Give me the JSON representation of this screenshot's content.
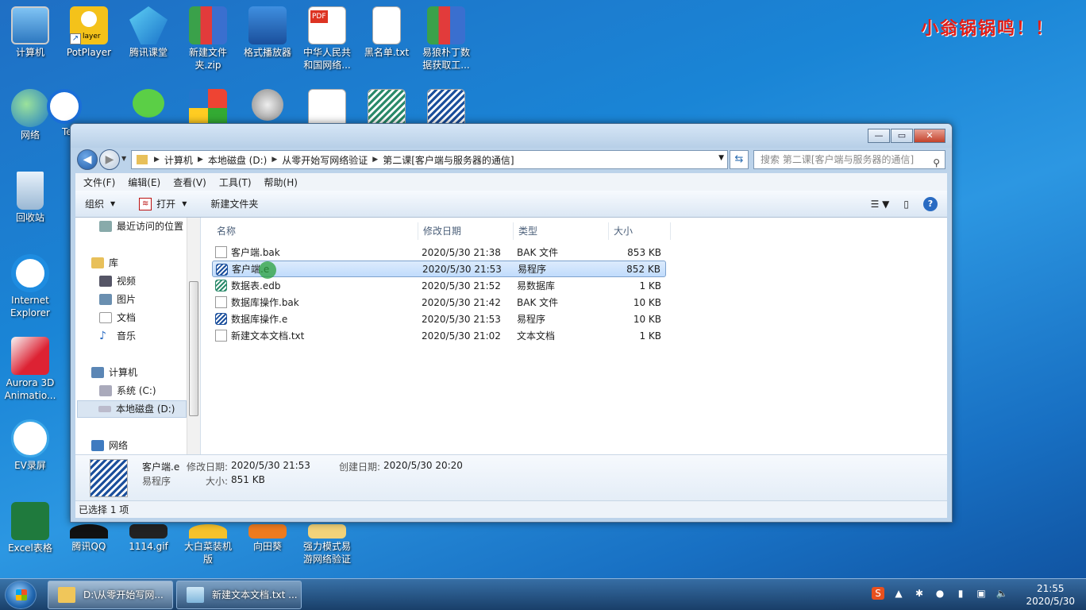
{
  "watermark": "小翁锅锅鸣！！",
  "desktop": {
    "icons": [
      {
        "label": "计算机"
      },
      {
        "label": "PotPlayer"
      },
      {
        "label": "腾讯课堂"
      },
      {
        "label": "新建文件夹.zip"
      },
      {
        "label": "格式播放器"
      },
      {
        "label": "中华人民共和国网络..."
      },
      {
        "label": "黑名单.txt"
      },
      {
        "label": "易狼朴丁数据获取工..."
      },
      {
        "label": "网络"
      },
      {
        "label": "Te"
      },
      {
        "label": "回收站"
      },
      {
        "label": "Internet Explorer"
      },
      {
        "label": "Aurora 3D Animatio..."
      },
      {
        "label": "EV录屏"
      },
      {
        "label": "Excel表格"
      },
      {
        "label": "腾讯QQ"
      },
      {
        "label": "1114.gif"
      },
      {
        "label": "大白菜装机版"
      },
      {
        "label": "向田葵"
      },
      {
        "label": "强力模式易游网络验证"
      }
    ],
    "potplayer_badge": "layer"
  },
  "window": {
    "breadcrumb": [
      "计算机",
      "本地磁盘 (D:)",
      "从零开始写网络验证",
      "第二课[客户端与服务器的通信]"
    ],
    "search_placeholder": "搜索 第二课[客户端与服务器的通信]",
    "menus": [
      "文件(F)",
      "编辑(E)",
      "查看(V)",
      "工具(T)",
      "帮助(H)"
    ],
    "toolbar": {
      "organize": "组织",
      "open": "打开",
      "new_folder": "新建文件夹"
    },
    "nav": {
      "recent": "最近访问的位置",
      "libraries": "库",
      "video": "视频",
      "pictures": "图片",
      "documents": "文档",
      "music": "音乐",
      "computer": "计算机",
      "drive_c": "系统 (C:)",
      "drive_d": "本地磁盘 (D:)",
      "network": "网络"
    },
    "columns": {
      "name": "名称",
      "modified": "修改日期",
      "type": "类型",
      "size": "大小"
    },
    "files": [
      {
        "name": "客户端.bak",
        "modified": "2020/5/30 21:38",
        "type": "BAK 文件",
        "size": "853 KB",
        "icon": "doc-icon"
      },
      {
        "name": "客户端.e",
        "modified": "2020/5/30 21:53",
        "type": "易程序",
        "size": "852 KB",
        "icon": "e-program-icon",
        "selected": true
      },
      {
        "name": "数据表.edb",
        "modified": "2020/5/30 21:52",
        "type": "易数据库",
        "size": "1 KB",
        "icon": "e-database-icon"
      },
      {
        "name": "数据库操作.bak",
        "modified": "2020/5/30 21:42",
        "type": "BAK 文件",
        "size": "10 KB",
        "icon": "doc-icon"
      },
      {
        "name": "数据库操作.e",
        "modified": "2020/5/30 21:53",
        "type": "易程序",
        "size": "10 KB",
        "icon": "e-program-icon"
      },
      {
        "name": "新建文本文档.txt",
        "modified": "2020/5/30 21:02",
        "type": "文本文档",
        "size": "1 KB",
        "icon": "doc-icon"
      }
    ],
    "details": {
      "filename": "客户端.e",
      "modified_label": "修改日期:",
      "modified": "2020/5/30 21:53",
      "created_label": "创建日期:",
      "created": "2020/5/30 20:20",
      "type": "易程序",
      "size_label": "大小:",
      "size": "851 KB"
    },
    "status": "已选择 1 项"
  },
  "taskbar": {
    "tasks": [
      "D:\\从零开始写网...",
      "新建文本文档.txt ..."
    ],
    "time": "21:55",
    "date": "2020/5/30"
  },
  "colors": {
    "selection": "#c1dcfc",
    "accent": "#1b4f9c"
  }
}
